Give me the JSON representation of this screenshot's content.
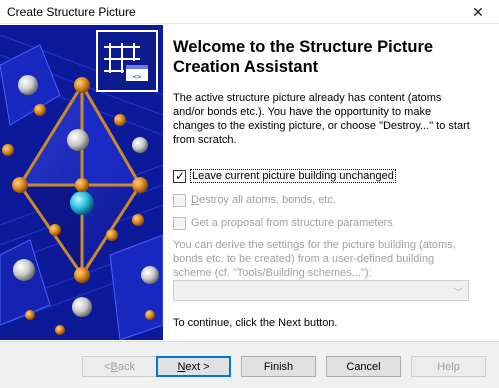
{
  "window": {
    "title": "Create Structure Picture",
    "close_glyph": "✕"
  },
  "sidebar": {
    "logo_icon": "structure-grid-icon",
    "background_color": "#1020a8"
  },
  "content": {
    "heading_line1": "Welcome to the Structure Picture",
    "heading_line2": "Creation Assistant",
    "intro": "The active structure picture already has content (atoms and/or bonds etc.). You have the opportunity to make changes to the existing picture, or choose \"Destroy...\" to start from scratch.",
    "options": {
      "leave": {
        "label": "Leave current picture building unchanged",
        "checked": true,
        "enabled": true
      },
      "destroy": {
        "label_prefix": "",
        "label_mnemonic": "D",
        "label_rest": "estroy all atoms, bonds, etc.",
        "checked": false,
        "enabled": false
      },
      "proposal": {
        "label": "Get a proposal from structure parameters",
        "checked": false,
        "enabled": false
      }
    },
    "derive_text": "You can derive the settings for the picture building (atoms, bonds etc. to be created) from a user-defined building scheme (cf. \"Tools/Building schemes...\"):",
    "scheme_combo_value": "",
    "continue_text": "To continue, click the Next button."
  },
  "buttons": {
    "back": {
      "mnemonic": "B",
      "prefix": "< ",
      "rest": "ack",
      "enabled": false
    },
    "next": {
      "mnemonic": "N",
      "prefix": "",
      "rest": "ext >",
      "enabled": true
    },
    "finish": {
      "label": "Finish",
      "enabled": true
    },
    "cancel": {
      "label": "Cancel",
      "enabled": true
    },
    "help": {
      "label": "Help",
      "enabled": false
    }
  }
}
